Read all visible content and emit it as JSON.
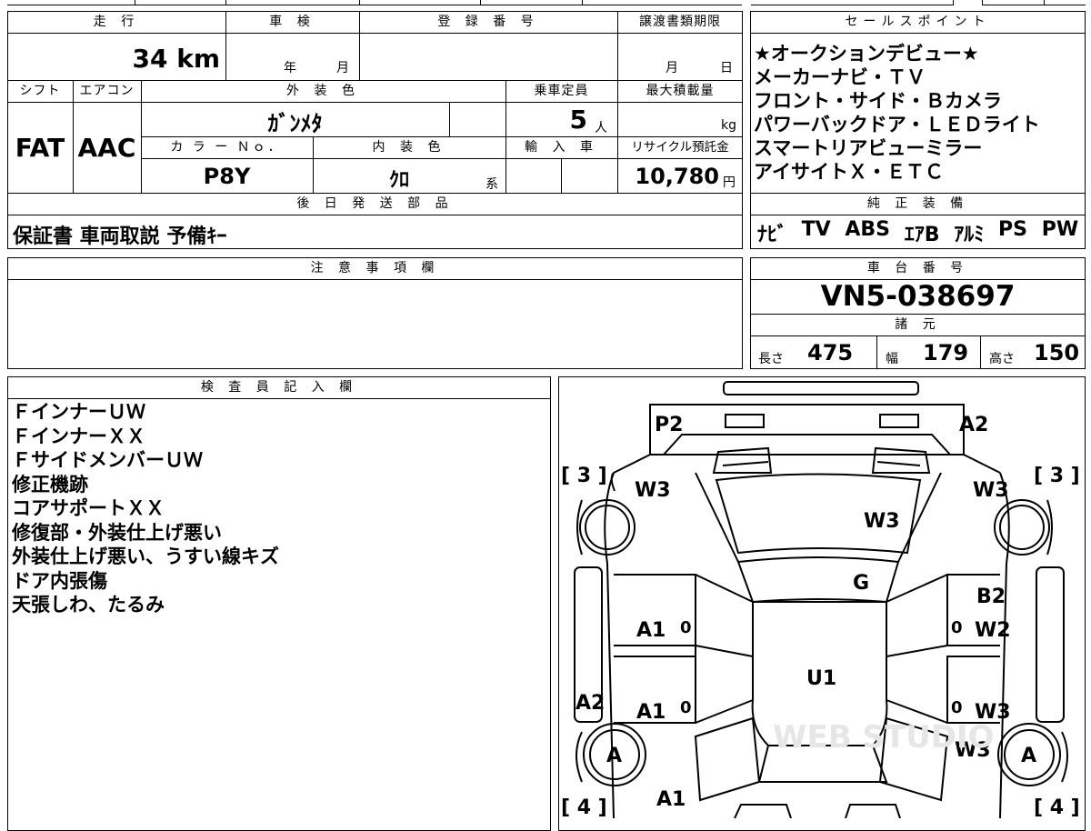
{
  "top_form": {
    "mileage": {
      "label": "走 行",
      "value": "34",
      "unit": "km"
    },
    "shaken": {
      "label": "車 検",
      "year_unit": "年",
      "month_unit": "月"
    },
    "registration_number": {
      "label": "登 録 番 号",
      "value": ""
    },
    "transfer_deadline": {
      "label": "譲渡書類期限",
      "month_unit": "月",
      "day_unit": "日"
    },
    "shift": {
      "label": "シフト",
      "value": "FAT"
    },
    "aircon": {
      "label": "エアコン",
      "value": "AAC"
    },
    "exterior_color": {
      "label": "外 装 色",
      "value": "ｶﾞﾝﾒﾀ"
    },
    "capacity": {
      "label": "乗車定員",
      "value": "5",
      "unit": "人"
    },
    "max_load": {
      "label": "最大積載量",
      "unit": "kg"
    },
    "color_no": {
      "label": "カ ラ ー Ｎｏ．",
      "value": "P8Y"
    },
    "interior_color": {
      "label": "内 装 色",
      "value": "ｸﾛ",
      "suffix": "系"
    },
    "import": {
      "label": "輸 入 車"
    },
    "recycle_fee": {
      "label": "リサイクル預託金",
      "value": "10,780",
      "unit": "円"
    },
    "deferred_parts": {
      "label": "後 日 発 送 部 品",
      "value": "保証書 車両取説 予備ｷｰ"
    }
  },
  "sales_points": {
    "label": "セールスポイント",
    "items": [
      "★オークションデビュー★",
      "メーカーナビ・ＴＶ",
      "フロント・サイド・Ｂカメラ",
      "パワーバックドア・ＬＥＤライト",
      "スマートリアビューミラー",
      "アイサイトＸ・ＥＴＣ"
    ]
  },
  "genuine_equipment": {
    "label": "純 正 装 備",
    "items": [
      "ﾅﾋﾞ",
      "TV",
      "ABS",
      "ｴｱB",
      "ｱﾙﾐ",
      "PS",
      "PW"
    ]
  },
  "notes": {
    "label": "注 意 事 項 欄",
    "value": ""
  },
  "chassis": {
    "label": "車 台 番 号",
    "value": "VN5-038697"
  },
  "specs": {
    "label": "諸 元",
    "length": {
      "label": "長さ",
      "value": "475"
    },
    "width": {
      "label": "幅",
      "value": "179"
    },
    "height": {
      "label": "高さ",
      "value": "150"
    }
  },
  "inspector": {
    "label": "検 査 員 記 入 欄",
    "lines": [
      "ＦインナーＵＷ",
      "ＦインナーＸＸ",
      "ＦサイドメンバーＵＷ",
      "修正機跡",
      "コアサポートＸＸ",
      "修復部・外装仕上げ悪い",
      "外装仕上げ悪い、うすい線キズ",
      "ドア内張傷",
      "天張しわ、たるみ"
    ]
  },
  "diagram": {
    "tire_fl": "[ 3 ]",
    "tire_fr": "[ 3 ]",
    "tire_rl": "[ 4 ]",
    "tire_rr": "[ 4 ]",
    "marks": {
      "front_bumper_left": "P2",
      "front_bumper_right": "A2",
      "fender_left": "W3",
      "fender_right": "W3",
      "hood": "W3",
      "windshield": "G",
      "pillar_right": "B2",
      "front_door_left": "A1",
      "front_door_right": "W2",
      "roof": "U1",
      "rear_door_left": "A1",
      "rear_door_right": "W3",
      "rocker_left": "A2",
      "quarter_right": "W3",
      "wheel_rl": "A",
      "wheel_rr": "A",
      "rear_left": "A1"
    },
    "zeros": [
      "0",
      "0",
      "0",
      "0"
    ],
    "watermark": "WEB STUDIO"
  }
}
